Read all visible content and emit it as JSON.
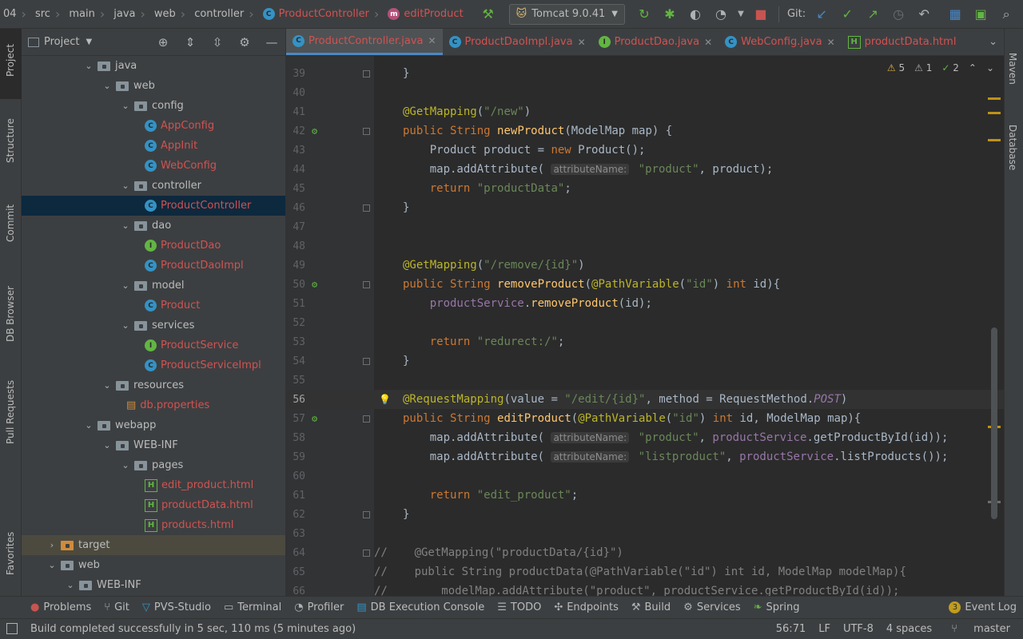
{
  "breadcrumb": [
    "04",
    "src",
    "main",
    "java",
    "web",
    "controller",
    "ProductController",
    "editProduct"
  ],
  "run_config": "Tomcat 9.0.41",
  "git_label": "Git:",
  "left_tabs": [
    "Project",
    "Structure",
    "Commit",
    "DB Browser",
    "Pull Requests",
    "Favorites"
  ],
  "right_tabs": [
    "Maven",
    "Database"
  ],
  "project": {
    "title": "Project",
    "tree": [
      {
        "label": "java",
        "kind": "folder",
        "depth": 3,
        "open": true
      },
      {
        "label": "web",
        "kind": "folder",
        "depth": 4,
        "open": true
      },
      {
        "label": "config",
        "kind": "folder",
        "depth": 5,
        "open": true
      },
      {
        "label": "AppConfig",
        "kind": "class",
        "depth": 6
      },
      {
        "label": "AppInit",
        "kind": "class",
        "depth": 6
      },
      {
        "label": "WebConfig",
        "kind": "class",
        "depth": 6
      },
      {
        "label": "controller",
        "kind": "folder",
        "depth": 5,
        "open": true
      },
      {
        "label": "ProductController",
        "kind": "class",
        "depth": 6,
        "selected": true
      },
      {
        "label": "dao",
        "kind": "folder",
        "depth": 5,
        "open": true
      },
      {
        "label": "ProductDao",
        "kind": "interface",
        "depth": 6
      },
      {
        "label": "ProductDaoImpl",
        "kind": "class",
        "depth": 6
      },
      {
        "label": "model",
        "kind": "folder",
        "depth": 5,
        "open": true
      },
      {
        "label": "Product",
        "kind": "class",
        "depth": 6
      },
      {
        "label": "services",
        "kind": "folder",
        "depth": 5,
        "open": true
      },
      {
        "label": "ProductService",
        "kind": "interface",
        "depth": 6
      },
      {
        "label": "ProductServiceImpl",
        "kind": "class",
        "depth": 6
      },
      {
        "label": "resources",
        "kind": "folder",
        "depth": 4,
        "open": true
      },
      {
        "label": "db.properties",
        "kind": "props",
        "depth": 5
      },
      {
        "label": "webapp",
        "kind": "folder",
        "depth": 3,
        "open": true
      },
      {
        "label": "WEB-INF",
        "kind": "folder",
        "depth": 4,
        "open": true
      },
      {
        "label": "pages",
        "kind": "folder",
        "depth": 5,
        "open": true
      },
      {
        "label": "edit_product.html",
        "kind": "html",
        "depth": 6
      },
      {
        "label": "productData.html",
        "kind": "html",
        "depth": 6
      },
      {
        "label": "products.html",
        "kind": "html",
        "depth": 6
      },
      {
        "label": "target",
        "kind": "folder-orange",
        "depth": 1,
        "open": false,
        "dark": true
      },
      {
        "label": "web",
        "kind": "folder",
        "depth": 1,
        "open": true
      },
      {
        "label": "WEB-INF",
        "kind": "folder",
        "depth": 2,
        "open": true
      }
    ]
  },
  "tabs": [
    {
      "label": "ProductController.java",
      "icon": "C",
      "active": true
    },
    {
      "label": "ProductDaoImpl.java",
      "icon": "C"
    },
    {
      "label": "ProductDao.java",
      "icon": "I"
    },
    {
      "label": "WebConfig.java",
      "icon": "C"
    },
    {
      "label": "productData.html",
      "icon": "H"
    }
  ],
  "inspections": {
    "warnings": "5",
    "weak": "1",
    "ok": "2"
  },
  "current_line": 56,
  "code_lines": [
    {
      "n": 39,
      "t": "    }"
    },
    {
      "n": 40,
      "t": ""
    },
    {
      "n": 41,
      "t": "    @GetMapping(\"/new\")"
    },
    {
      "n": 42,
      "t": "    public String newProduct(ModelMap map) {"
    },
    {
      "n": 43,
      "t": "        Product product = new Product();"
    },
    {
      "n": 44,
      "t": "        map.addAttribute( attributeName: \"product\", product);"
    },
    {
      "n": 45,
      "t": "        return \"productData\";"
    },
    {
      "n": 46,
      "t": "    }"
    },
    {
      "n": 47,
      "t": ""
    },
    {
      "n": 48,
      "t": ""
    },
    {
      "n": 49,
      "t": "    @GetMapping(\"/remove/{id}\")"
    },
    {
      "n": 50,
      "t": "    public String removeProduct(@PathVariable(\"id\") int id){"
    },
    {
      "n": 51,
      "t": "        productService.removeProduct(id);"
    },
    {
      "n": 52,
      "t": ""
    },
    {
      "n": 53,
      "t": "        return \"redurect:/\";"
    },
    {
      "n": 54,
      "t": "    }"
    },
    {
      "n": 55,
      "t": ""
    },
    {
      "n": 56,
      "t": "    @RequestMapping(value = \"/edit/{id}\", method = RequestMethod.POST)"
    },
    {
      "n": 57,
      "t": "    public String editProduct(@PathVariable(\"id\") int id, ModelMap map){"
    },
    {
      "n": 58,
      "t": "        map.addAttribute( attributeName: \"product\", productService.getProductById(id));"
    },
    {
      "n": 59,
      "t": "        map.addAttribute( attributeName: \"listproduct\", productService.listProducts());"
    },
    {
      "n": 60,
      "t": ""
    },
    {
      "n": 61,
      "t": "        return \"edit_product\";"
    },
    {
      "n": 62,
      "t": "    }"
    },
    {
      "n": 63,
      "t": ""
    },
    {
      "n": 64,
      "t": "//    @GetMapping(\"productData/{id}\")"
    },
    {
      "n": 65,
      "t": "//    public String productData(@PathVariable(\"id\") int id, ModelMap modelMap){"
    },
    {
      "n": 66,
      "t": "//        modelMap.addAttribute(\"product\", productService.getProductById(id));"
    }
  ],
  "tool_windows": [
    "Problems",
    "Git",
    "PVS-Studio",
    "Terminal",
    "Profiler",
    "DB Execution Console",
    "TODO",
    "Endpoints",
    "Build",
    "Services",
    "Spring",
    "Event Log"
  ],
  "event_log_count": "3",
  "status": {
    "message": "Build completed successfully in 5 sec, 110 ms (5 minutes ago)",
    "position": "56:71",
    "line_sep": "LF",
    "encoding": "UTF-8",
    "indent": "4 spaces",
    "branch": "master"
  }
}
